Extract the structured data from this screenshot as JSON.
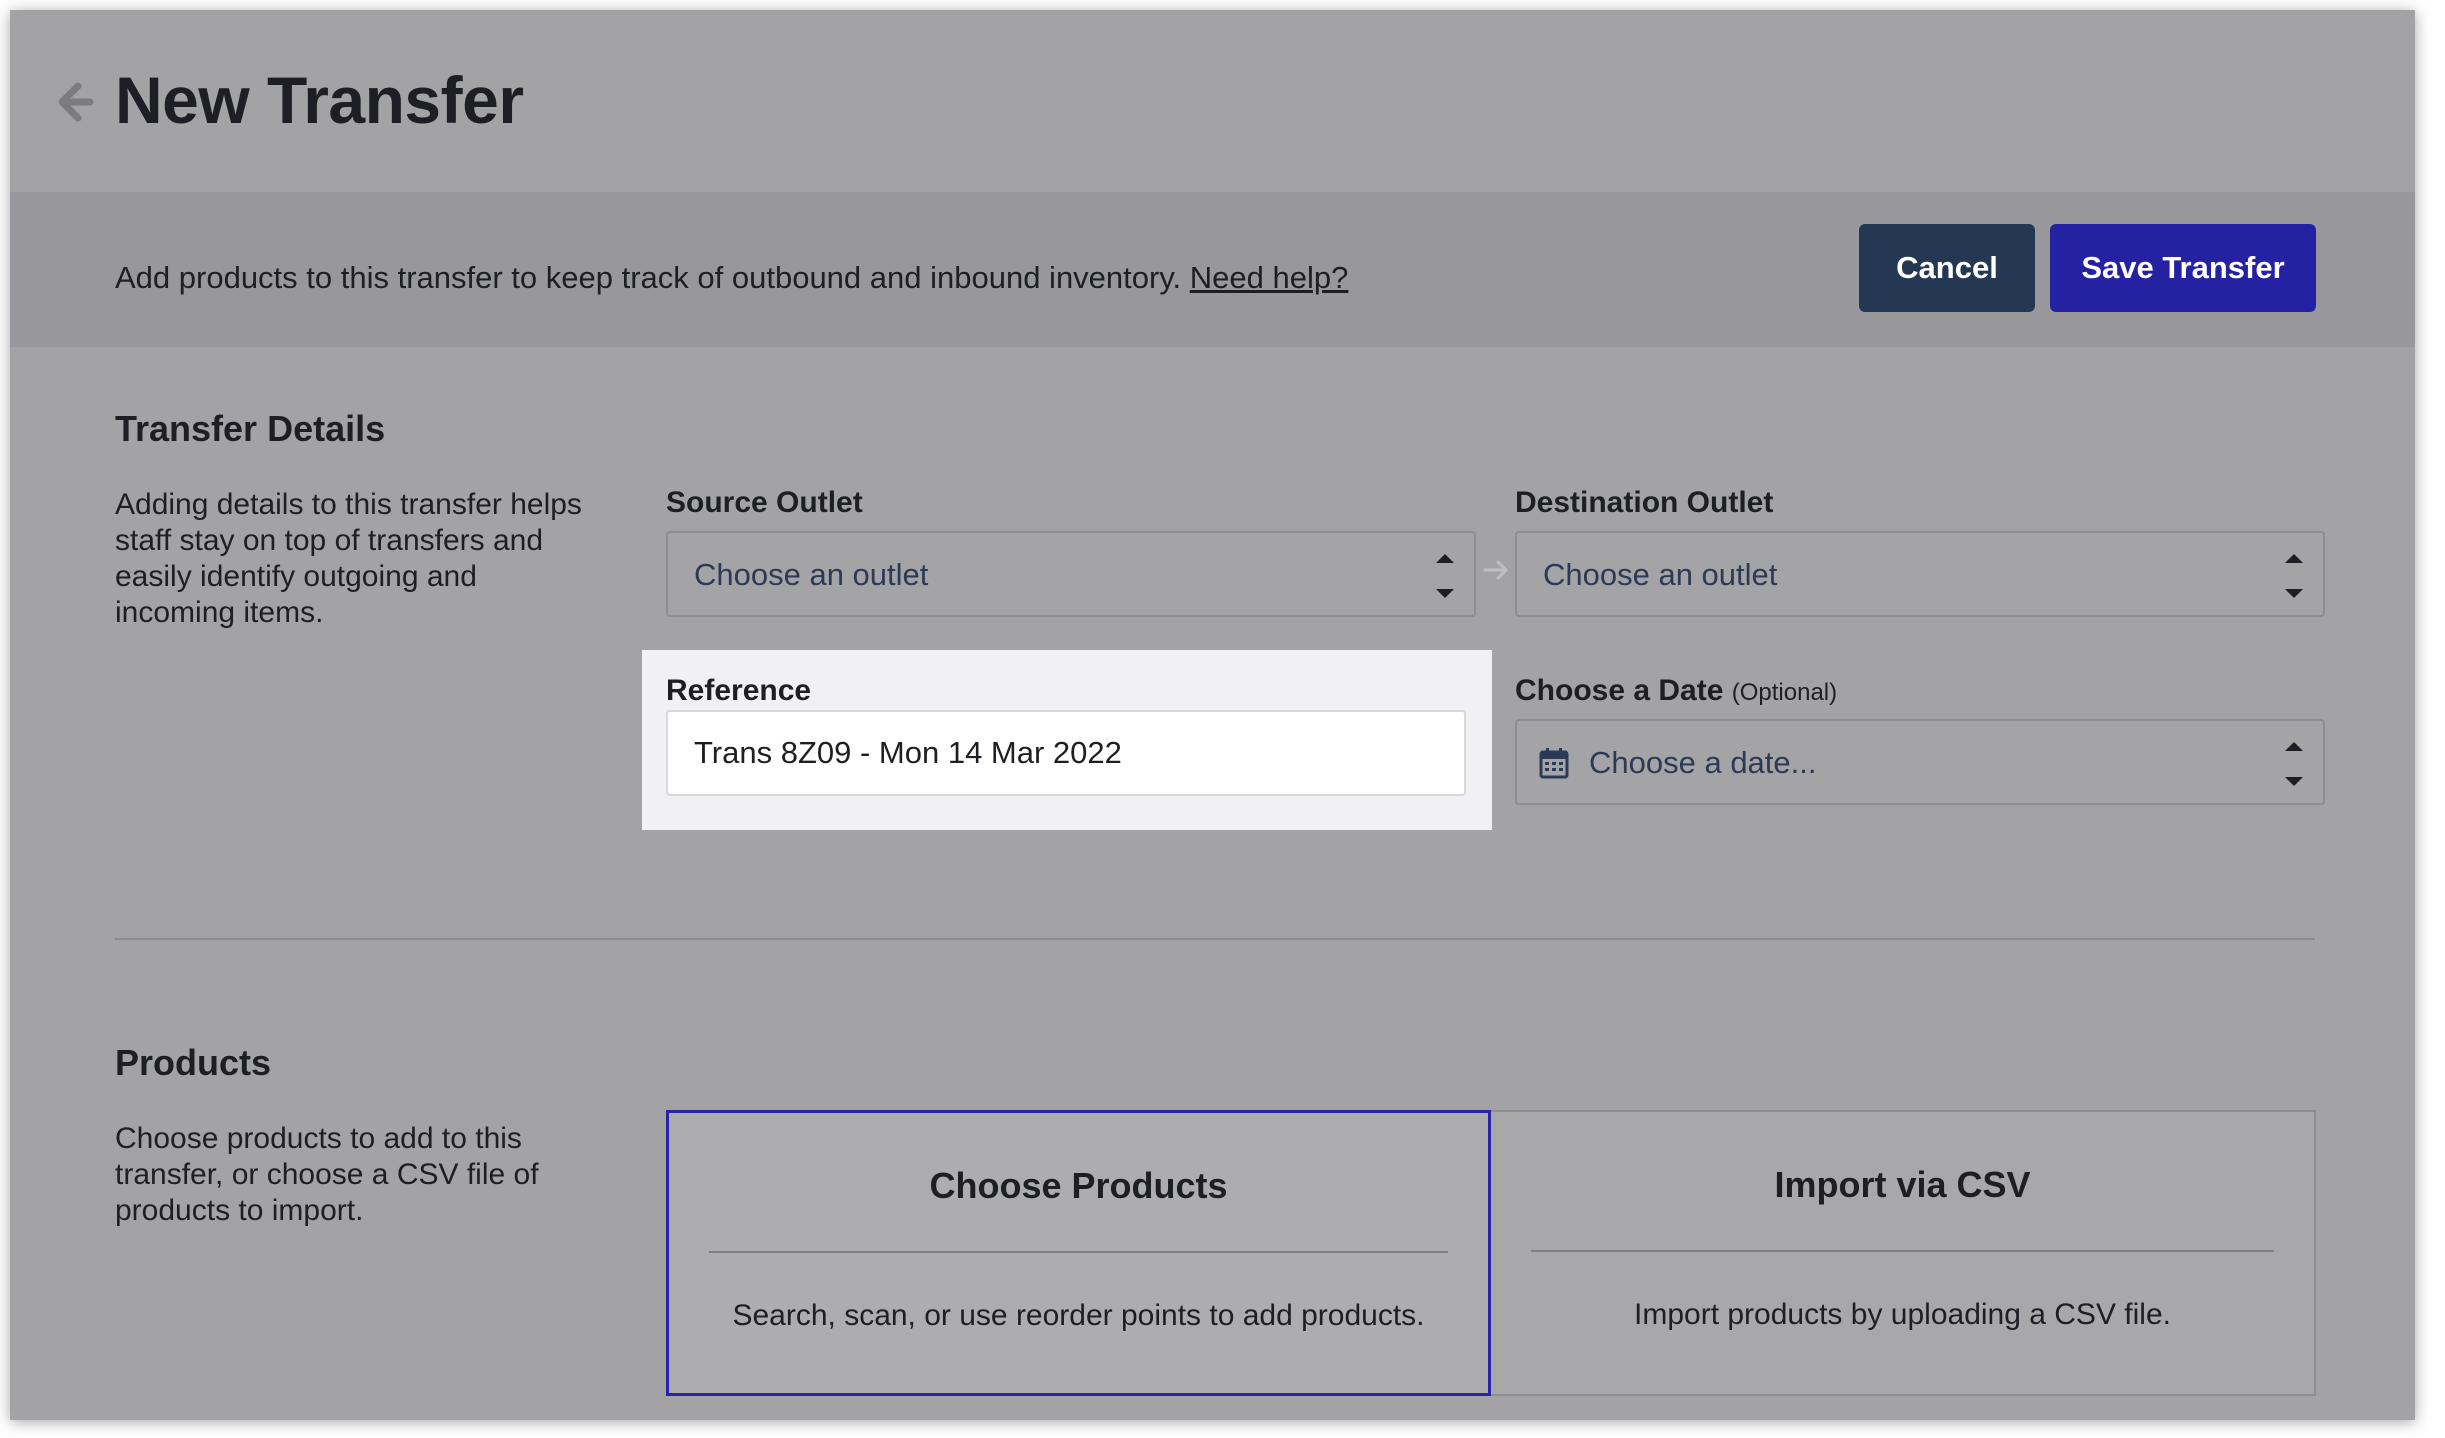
{
  "header": {
    "title": "New Transfer"
  },
  "banner": {
    "text": "Add products to this transfer to keep track of outbound and inbound inventory.",
    "help_link": "Need help?",
    "cancel_label": "Cancel",
    "save_label": "Save Transfer"
  },
  "transfer_details": {
    "title": "Transfer Details",
    "description": "Adding details to this transfer helps staff stay on top of transfers and easily identify outgoing and incoming items.",
    "source": {
      "label": "Source Outlet",
      "value": "Choose an outlet"
    },
    "destination": {
      "label": "Destination Outlet",
      "value": "Choose an outlet"
    },
    "reference": {
      "label": "Reference",
      "value": "Trans 8Z09 - Mon 14 Mar 2022"
    },
    "date": {
      "label": "Choose a Date",
      "optional": "(Optional)",
      "placeholder": "Choose a date..."
    }
  },
  "products": {
    "title": "Products",
    "description": "Choose products to add to this transfer, or choose a CSV file of products to import.",
    "options": [
      {
        "title": "Choose Products",
        "description": "Search, scan, or use reorder points to add products."
      },
      {
        "title": "Import via CSV",
        "description": "Import products by uploading a CSV file."
      }
    ]
  },
  "colors": {
    "primary": "#2421a3",
    "secondary": "#243753",
    "overlay": "#a3a3a6",
    "highlight": "#f1f1f3"
  },
  "icons": [
    "back-arrow-icon",
    "arrow-right-icon",
    "calendar-icon",
    "spinner-icon"
  ]
}
